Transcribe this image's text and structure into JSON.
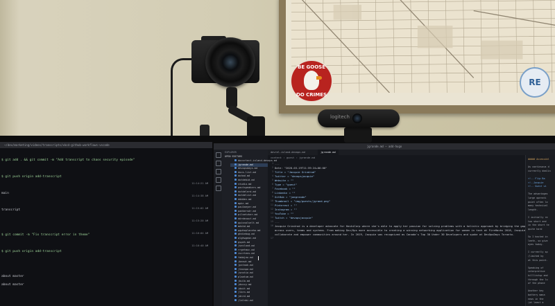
{
  "wall": {
    "goose_sticker_top": "BE GOOSE",
    "goose_sticker_bottom": "DO CRIMES",
    "re_sticker": "RE"
  },
  "webcam": {
    "brand": "logitech"
  },
  "left_monitor": {
    "title": "~/dev/marketing/videos/transcripts/xkcd-github-workflows-vscode",
    "lines": [
      {
        "text": "$ git add . && git commit -m \"Add transcript to chaos security episode\"",
        "kind": "cmd"
      },
      {
        "text": "",
        "kind": "plain"
      },
      {
        "text": "$ git push origin add-transcript",
        "kind": "cmd"
      },
      {
        "text": "",
        "kind": "plain"
      },
      {
        "text": "main",
        "kind": "plain"
      },
      {
        "text": "",
        "kind": "plain"
      },
      {
        "text": "transcript",
        "kind": "plain"
      },
      {
        "text": "",
        "kind": "plain"
      },
      {
        "text": "",
        "kind": "plain"
      },
      {
        "text": "$ git commit -m \"Fix transcript error in theme\"",
        "kind": "cmd"
      },
      {
        "text": "",
        "kind": "plain"
      },
      {
        "text": "$ git push origin add-transcript",
        "kind": "cmd"
      },
      {
        "text": "",
        "kind": "plain"
      },
      {
        "text": "",
        "kind": "plain"
      },
      {
        "text": "about master",
        "kind": "plain"
      },
      {
        "text": "about master",
        "kind": "plain"
      }
    ],
    "right_marks": [
      "11:14:21 AM",
      "11:14:38 AM",
      "11:15:02 AM",
      "11:15:20 AM",
      "11:16:04 AM",
      "11:16:40 AM"
    ]
  },
  "editor": {
    "window_title": "jgrande.md — add-hugo",
    "sidebar_title": "EXPLORER",
    "sidebar_header": "OPEN EDITORS",
    "files": [
      "docsrtect-island-devops.md",
      "jgrande.md",
      "devopsdays.md",
      "docs-list.md",
      "dotmd.md",
      "dotdebid.md",
      "studio.md",
      "pactspeakers.md",
      "dotdelerd.md",
      "dotdelist.md",
      "ddddev.md",
      "mpbr.md",
      "paulmeyer.md",
      "paekersdr.md",
      "pilsetzker.md",
      "ddrdevout.md",
      "ppisnolvelt.md",
      "mdshd.md",
      "pgwhoplaceho.md",
      "ghdiebug.md",
      "qlghwgeon.md",
      "gspeh.md",
      "jseclond.md",
      "rrgetmuc.md",
      "iscrtens.md",
      "fabbjeo.md",
      "jbeaut.md",
      "jpstaok.md",
      "jtaxnpo.md",
      "jsnstio.md",
      "plaatum.md",
      "jbulb.md",
      "jdoccy.md",
      "jdoit.md",
      "jlbrn.md",
      "jdnrd.md",
      "jlalnbi.md"
    ],
    "selected_file": "jgrande.md",
    "tabs": [
      "devrel-island-devops.md",
      "jgrande.md"
    ],
    "active_tab": "jgrande.md",
    "breadcrumb": "content › guest › jgrande.md",
    "code": [
      {
        "n": "1",
        "text": "---"
      },
      {
        "n": "2",
        "text": "Date: \"2020-03-19T11:59:24+00:00\""
      },
      {
        "n": "3",
        "text": "Title = \"Jacquie Grindrod\""
      },
      {
        "n": "4",
        "text": "Twitter = \"devopsjacquie\""
      },
      {
        "n": "5",
        "text": "Website = \"\""
      },
      {
        "n": "6",
        "text": "Type = \"guest\""
      },
      {
        "n": "7",
        "text": "Facebook = \"\""
      },
      {
        "n": "8",
        "text": "Linkedin = \"\""
      },
      {
        "n": "9",
        "text": "GitHub = \"jaegrande\""
      },
      {
        "n": "10",
        "text": "Thumbnail = \"img/guests/jgrand.png\""
      },
      {
        "n": "11",
        "text": "Pinterest = \"\""
      },
      {
        "n": "12",
        "text": "Instagram = \"\""
      },
      {
        "n": "13",
        "text": "YouTube = \"\""
      },
      {
        "n": "14",
        "text": "Twitch = \"devopsjacquie\""
      },
      {
        "n": "15",
        "text": "---"
      },
      {
        "n": "16",
        "text": "Jacquie Grindrod is a developer advocate for HashiCorp where she's able to apply her passion for solving problems with a holistic approach by bridging the gaps"
      },
      {
        "n": "",
        "text": "across users, teams and systems. From making Dev/Ops more accessible to creating a winning networking application for women in tech at FireHacks 2018, Jacquie works to"
      },
      {
        "n": "",
        "text": "collaborate and empower communities around her. In 2019, Jacquie was recognized as Canada's Top 30 Under 30 Developers and spoke at DevOpsDays Toronto."
      },
      {
        "n": "17",
        "text": ""
      }
    ],
    "preview": [
      "##### Accessibl",
      "",
      "As continuous d",
      "currently dealin",
      "",
      "<!-- Flip Ba",
      "<!--Jacquie",
      "<!-- Guest vi",
      "",
      "The advantages",
      "large operati",
      "point often lo",
      "many technical",
      "length.",
      "",
      "I initially re",
      "too short and",
      "in the short te",
      "quite hard",
      "",
      "So I hosted in",
      "leeth, so give",
      "eyes today.",
      "",
      "I currently sp",
      "(limited by",
      "at this point.",
      "",
      "Speaking of",
      "interpretive",
      "killlistup and",
      "through the lu",
      "of the phone",
      "",
      "Another key",
      "battery mana",
      "news in the",
      "(at least a"
    ]
  }
}
